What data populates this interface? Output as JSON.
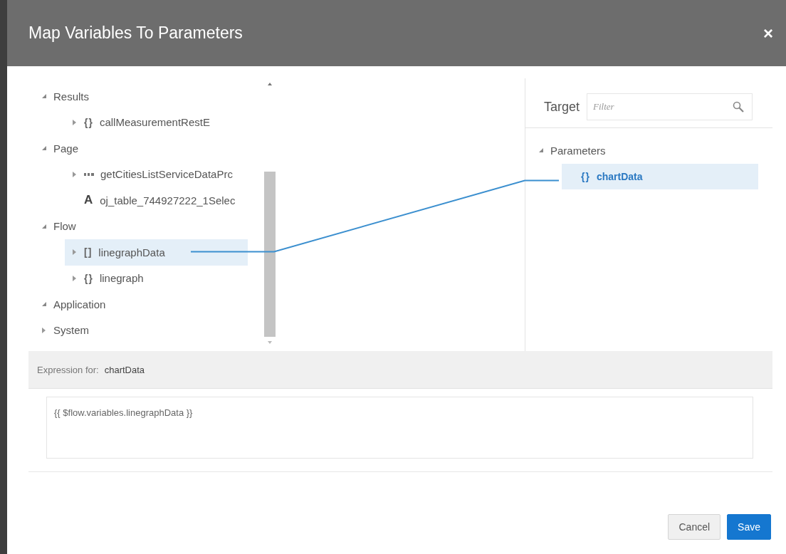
{
  "dialog": {
    "title": "Map Variables To Parameters",
    "close": "×"
  },
  "source_tree": [
    {
      "label": "Results",
      "expanded": true,
      "selected": false,
      "children": [
        {
          "label": "callMeasurementRestE",
          "icon": "{}",
          "expanded": false,
          "selected": false
        }
      ]
    },
    {
      "label": "Page",
      "expanded": true,
      "selected": false,
      "children": [
        {
          "label": "getCitiesListServiceDataPrc",
          "kind": "service",
          "expanded": false,
          "selected": false
        },
        {
          "label": "oj_table_744927222_1Selec",
          "icon": "A",
          "selected": false
        }
      ]
    },
    {
      "label": "Flow",
      "expanded": true,
      "selected": false,
      "children": [
        {
          "label": "linegraphData",
          "icon": "[]",
          "expanded": false,
          "selected": true
        },
        {
          "label": "linegraph",
          "icon": "{}",
          "expanded": false,
          "selected": false
        }
      ]
    },
    {
      "label": "Application",
      "expanded": true,
      "selected": false
    },
    {
      "label": "System",
      "expanded": false,
      "selected": false
    }
  ],
  "target": {
    "label": "Target",
    "filter_placeholder": "Filter",
    "tree": [
      {
        "label": "Parameters",
        "expanded": true,
        "selected": false,
        "children": [
          {
            "label": "chartData",
            "icon": "{}",
            "selected": true
          }
        ]
      }
    ]
  },
  "expression": {
    "label": "Expression for:",
    "name": "chartData",
    "value": "{{ $flow.variables.linegraphData }}"
  },
  "buttons": [
    {
      "label": "Cancel",
      "kind": "secondary"
    },
    {
      "label": "Save",
      "kind": "primary"
    }
  ]
}
